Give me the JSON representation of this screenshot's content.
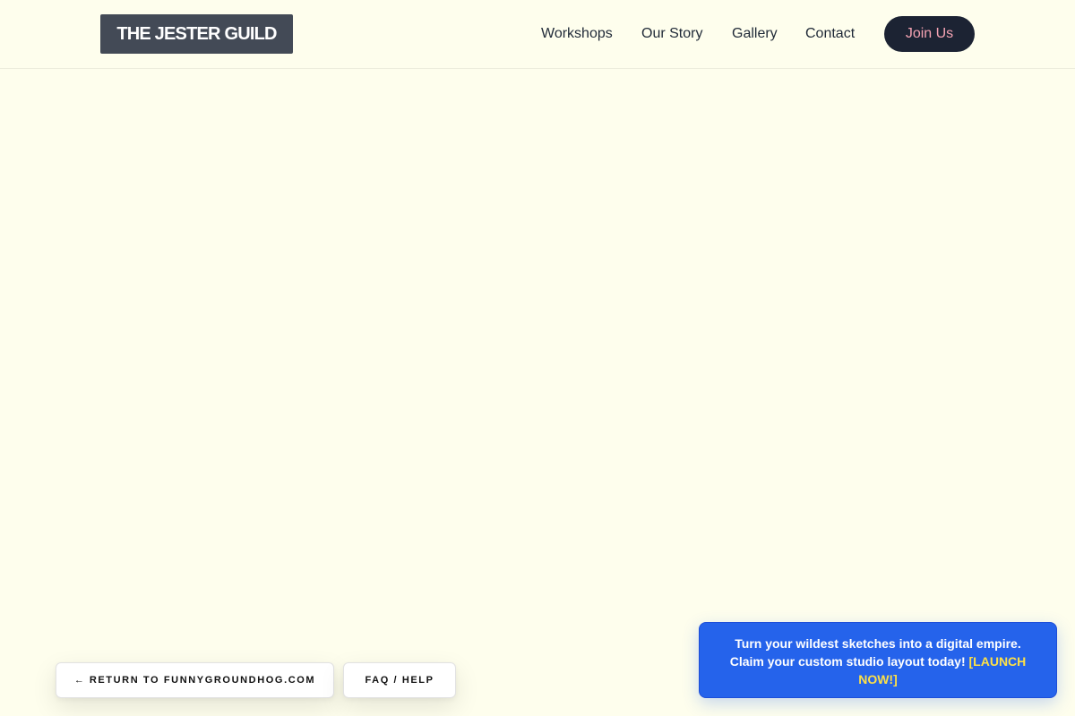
{
  "header": {
    "logo": "THE JESTER GUILD",
    "nav": {
      "workshops": "Workshops",
      "story": "Our Story",
      "gallery": "Gallery",
      "contact": "Contact"
    },
    "join_label": "Join Us"
  },
  "footer": {
    "return_arrow": "←",
    "return_label": "RETURN TO FUNNYGROUNDHOG.COM",
    "faq_label": "FAQ / HELP"
  },
  "promo": {
    "line1": "Turn your wildest sketches into a digital empire.",
    "line2": "Claim your custom studio layout today!",
    "cta": "[LAUNCH NOW!]"
  },
  "colors": {
    "page_background": "#fefeed",
    "logo_background": "#434a56",
    "join_background": "#1c2333",
    "join_text": "#f5a3b3",
    "promo_background": "#2563eb",
    "promo_cta": "#fde047"
  }
}
